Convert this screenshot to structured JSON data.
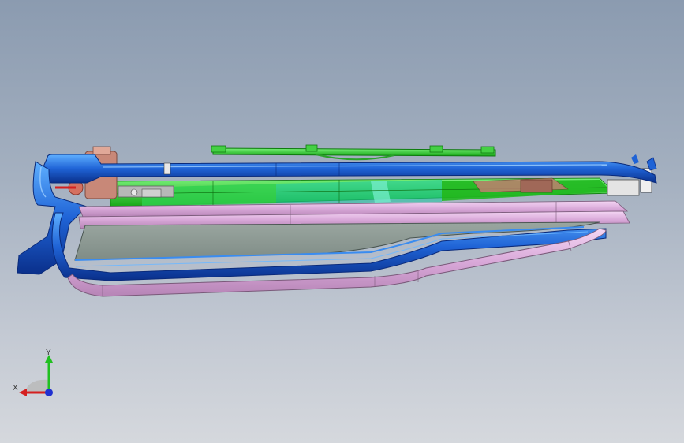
{
  "viewport": {
    "name": "3d-model-viewport"
  },
  "triad": {
    "x_label": "X",
    "y_label": "Y",
    "colors": {
      "x": "#d42020",
      "y": "#20c020",
      "z": "#2030d0"
    }
  },
  "model": {
    "colors": {
      "outer_frame": "#1f63d6",
      "inner_frame": "#3a8cf0",
      "seal": "#d8a8d8",
      "glass": "#8c9a94",
      "mechanism": "#22c422",
      "motor": "#c88878"
    }
  }
}
